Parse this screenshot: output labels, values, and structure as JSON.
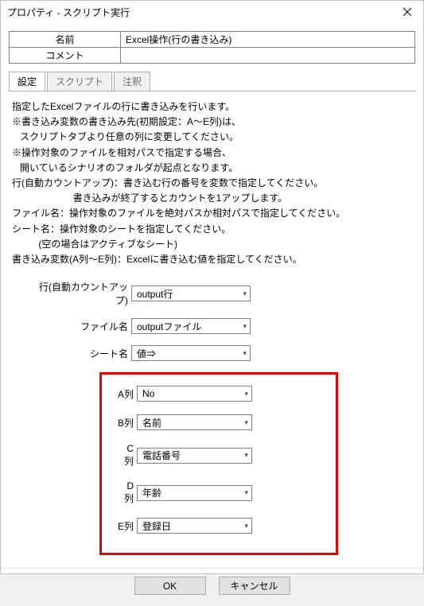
{
  "window": {
    "title": "プロパティ - スクリプト実行"
  },
  "header": {
    "name_label": "名前",
    "name_value": "Excel操作(行の書き込み)",
    "comment_label": "コメント",
    "comment_value": ""
  },
  "tabs": {
    "settings": "設定",
    "script": "スクリプト",
    "notes": "注釈"
  },
  "description": {
    "l1": "指定したExcelファイルの行に書き込みを行います。",
    "l2": "※書き込み変数の書き込み先(初期設定：A〜E列)は、",
    "l3": "   スクリプトタブより任意の列に変更してください。",
    "l4": "※操作対象のファイルを相対パスで指定する場合、",
    "l5": "   開いているシナリオのフォルダが起点となります。",
    "l6": "",
    "l7": "行(自動カウントアップ)：書き込む行の番号を変数で指定してください。",
    "l8": "                       書き込みが終了するとカウントを1アップします。",
    "l9": "ファイル名：操作対象のファイルを絶対パスか相対パスで指定してください。",
    "l10": "シート名：操作対象のシートを指定してください。",
    "l11": "          (空の場合はアクティブなシート)",
    "l12": "書き込み変数(A列〜E列)：Excelに書き込む値を指定してください。"
  },
  "form": {
    "row_label": "行(自動カウントアップ)",
    "row_value": "output行",
    "file_label": "ファイル名",
    "file_value": "outputファイル",
    "sheet_label": "シート名",
    "sheet_value": "値⇒",
    "columns": [
      {
        "label": "A列",
        "value": "No"
      },
      {
        "label": "B列",
        "value": "名前"
      },
      {
        "label": "C列",
        "value": "電話番号"
      },
      {
        "label": "D列",
        "value": "年齢"
      },
      {
        "label": "E列",
        "value": "登録日"
      }
    ]
  },
  "buttons": {
    "ok": "OK",
    "cancel": "キャンセル"
  }
}
